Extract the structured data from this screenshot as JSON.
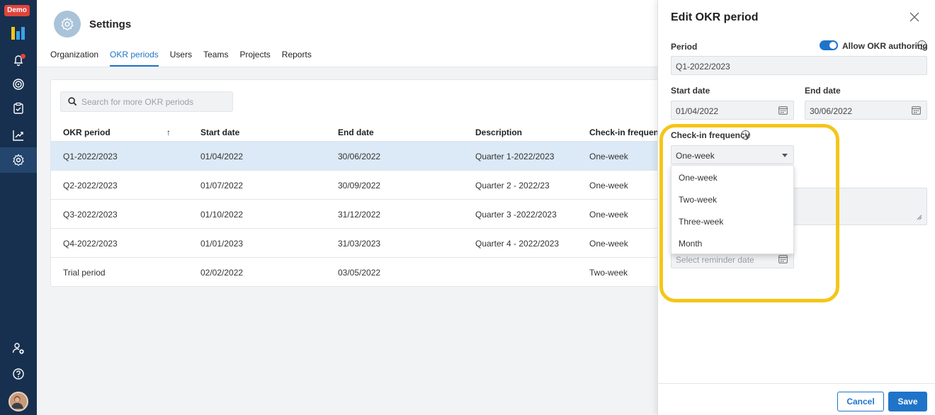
{
  "app": {
    "demo_badge": "Demo",
    "title": "Settings"
  },
  "rail": {
    "icons": [
      "logo-icon",
      "bell-icon",
      "target-icon",
      "clipboard-check-icon",
      "chart-trend-icon",
      "gear-icon",
      "user-add-icon",
      "help-icon",
      "avatar"
    ]
  },
  "tabs": [
    {
      "label": "Organization",
      "active": false
    },
    {
      "label": "OKR periods",
      "active": true
    },
    {
      "label": "Users",
      "active": false
    },
    {
      "label": "Teams",
      "active": false
    },
    {
      "label": "Projects",
      "active": false
    },
    {
      "label": "Reports",
      "active": false
    }
  ],
  "search": {
    "placeholder": "Search for more OKR periods"
  },
  "table": {
    "columns": [
      "OKR period",
      "Start date",
      "End date",
      "Description",
      "Check-in frequency"
    ],
    "sort_indicator": "↑",
    "rows": [
      [
        "Q1-2022/2023",
        "01/04/2022",
        "30/06/2022",
        "Quarter 1-2022/2023",
        "One-week"
      ],
      [
        "Q2-2022/2023",
        "01/07/2022",
        "30/09/2022",
        "Quarter 2 - 2022/23",
        "One-week"
      ],
      [
        "Q3-2022/2023",
        "01/10/2022",
        "31/12/2022",
        "Quarter 3 -2022/2023",
        "One-week"
      ],
      [
        "Q4-2022/2023",
        "01/01/2023",
        "31/03/2023",
        "Quarter 4 - 2022/2023",
        "One-week"
      ],
      [
        "Trial period",
        "02/02/2022",
        "03/05/2022",
        "",
        "Two-week"
      ]
    ]
  },
  "panel": {
    "title": "Edit OKR period",
    "period_label": "Period",
    "allow_label": "Allow OKR authoring",
    "period_value": "Q1-2022/2023",
    "start_label": "Start date",
    "start_value": "01/04/2022",
    "end_label": "End date",
    "end_value": "30/06/2022",
    "frequency_label": "Check-in frequency",
    "frequency_value": "One-week",
    "options": [
      "One-week",
      "Two-week",
      "Three-week",
      "Month"
    ],
    "reminder_placeholder": "Select reminder date",
    "cancel_label": "Cancel",
    "save_label": "Save"
  },
  "colors": {
    "accent": "#1f74c9",
    "highlight": "#f5c518",
    "rail": "#17304f"
  }
}
